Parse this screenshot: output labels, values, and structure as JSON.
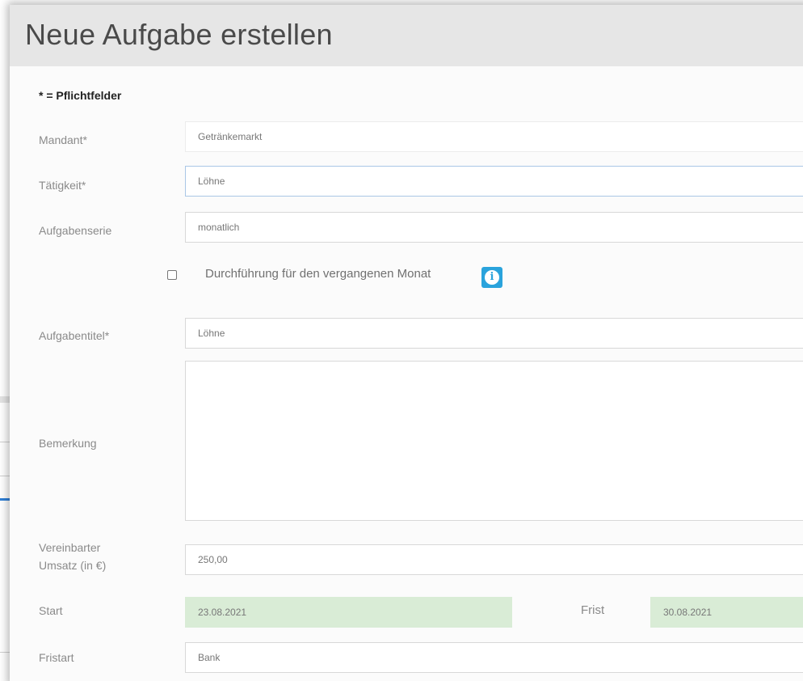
{
  "dialog": {
    "title": "Neue Aufgabe erstellen",
    "required_note": "* = Pflichtfelder"
  },
  "form": {
    "mandant": {
      "label": "Mandant*",
      "value": "Getränkemarkt"
    },
    "taetigkeit": {
      "label": "Tätigkeit*",
      "value": "Löhne"
    },
    "aufgabenserie": {
      "label": "Aufgabenserie",
      "value": "monatlich"
    },
    "vergangener_monat": {
      "label": "Durchführung für den vergangenen Monat",
      "checked": false
    },
    "aufgabentitel": {
      "label": "Aufgabentitel*",
      "value": "Löhne"
    },
    "bemerkung": {
      "label": "Bemerkung",
      "value": ""
    },
    "umsatz": {
      "label_line1": "Vereinbarter",
      "label_line2": "Umsatz (in €)",
      "value": "250,00"
    },
    "start": {
      "label": "Start",
      "value": "23.08.2021"
    },
    "frist": {
      "label": "Frist",
      "value": "30.08.2021"
    },
    "fristart": {
      "label": "Fristart",
      "value": "Bank"
    }
  },
  "icons": {
    "info": "info-icon"
  },
  "colors": {
    "header_bg": "#e6e6e6",
    "date_field_bg": "#d9ecd6",
    "info_button": "#2aa3dc",
    "focus_border": "#aac7e6"
  }
}
